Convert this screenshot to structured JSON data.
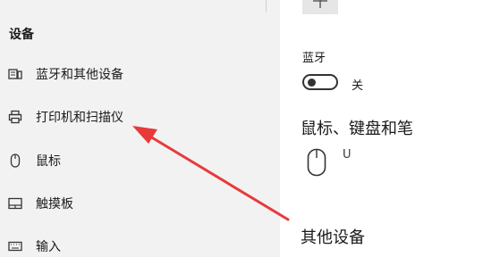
{
  "sidebar": {
    "section_title": "设备",
    "items": [
      {
        "label": "蓝牙和其他设备",
        "icon": "devices-icon"
      },
      {
        "label": "打印机和扫描仪",
        "icon": "printer-icon"
      },
      {
        "label": "鼠标",
        "icon": "mouse-icon"
      },
      {
        "label": "触摸板",
        "icon": "touchpad-icon"
      },
      {
        "label": "输入",
        "icon": "keyboard-icon"
      }
    ]
  },
  "main": {
    "add_button_icon": "plus-icon",
    "bluetooth_label": "蓝牙",
    "bluetooth_state": "关",
    "mouse_keyboard_heading": "鼠标、键盘和笔",
    "mouse_device_name": "U",
    "other_devices_heading": "其他设备"
  },
  "annotation": {
    "arrow_color": "#e8393b"
  }
}
